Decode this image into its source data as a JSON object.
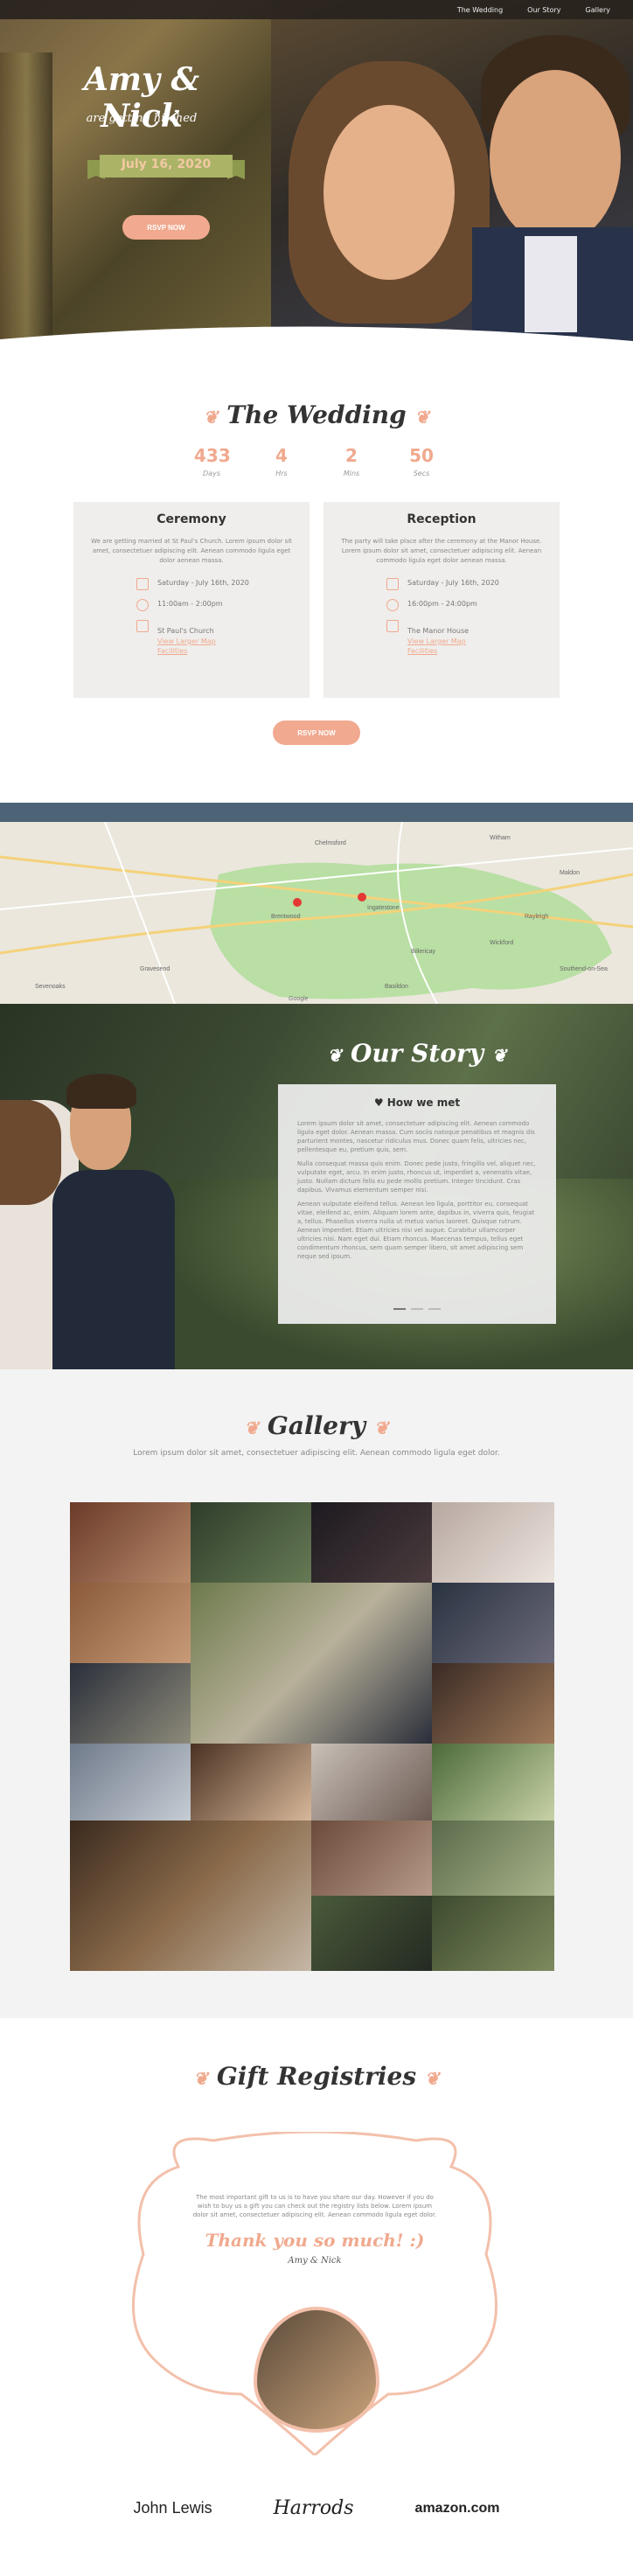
{
  "nav": {
    "items": [
      "The Wedding",
      "Our Story",
      "Gallery"
    ]
  },
  "hero": {
    "title": "Amy & Nick",
    "subtitle": "are getting hitched",
    "date": "July 16, 2020",
    "rsvp_label": "RSVP NOW"
  },
  "wedding": {
    "title": "The Wedding",
    "countdown": [
      {
        "value": "433",
        "label": "Days"
      },
      {
        "value": "4",
        "label": "Hrs"
      },
      {
        "value": "2",
        "label": "Mins"
      },
      {
        "value": "50",
        "label": "Secs"
      }
    ],
    "ceremony": {
      "title": "Ceremony",
      "desc": "We are getting married at St Paul's Church. Lorem ipsum dolor sit amet, consectetuer adipiscing elit. Aenean commodo ligula eget dolor aenean massa.",
      "date": "Saturday - July 16th, 2020",
      "time": "11:00am - 2:00pm",
      "venue": "St Paul's Church",
      "link1": "View Larger Map",
      "link2": "Facilities"
    },
    "reception": {
      "title": "Reception",
      "desc": "The party will take place after the ceremony at the Manor House. Lorem ipsum dolor sit amet, consectetuer adipiscing elit. Aenean commodo ligula eget dolor aenean massa.",
      "date": "Saturday - July 16th, 2020",
      "time": "16:00pm - 24:00pm",
      "venue": "The Manor House",
      "link1": "View Larger Map",
      "link2": "Facilities"
    },
    "rsvp_label": "RSVP NOW"
  },
  "map": {
    "places": [
      "Chelmsford",
      "Ingatestone",
      "Billericay",
      "Brentwood",
      "Basildon",
      "Witham",
      "Maldon",
      "Southend-on-Sea",
      "Wickford",
      "Rayleigh",
      "Sevenoaks",
      "Gravesend"
    ],
    "footer": "Google",
    "pin_color": "#e53935"
  },
  "story": {
    "title": "Our Story",
    "card_title": "How we met",
    "paragraphs": [
      "Lorem ipsum dolor sit amet, consectetuer adipiscing elit. Aenean commodo ligula eget dolor. Aenean massa. Cum sociis natoque penatibus et magnis dis parturient montes, nascetur ridiculus mus. Donec quam felis, ultricies nec, pellentesque eu, pretium quis, sem.",
      "Nulla consequat massa quis enim. Donec pede justo, fringilla vel, aliquet nec, vulputate eget, arcu. In enim justo, rhoncus ut, imperdiet a, venenatis vitae, justo. Nullam dictum felis eu pede mollis pretium. Integer tincidunt. Cras dapibus. Vivamus elementum semper nisi.",
      "Aenean vulputate eleifend tellus. Aenean leo ligula, porttitor eu, consequat vitae, eleifend ac, enim. Aliquam lorem ante, dapibus in, viverra quis, feugiat a, tellus. Phasellus viverra nulla ut metus varius laoreet. Quisque rutrum. Aenean imperdiet. Etiam ultricies nisi vel augue. Curabitur ullamcorper ultricies nisi. Nam eget dui. Etiam rhoncus. Maecenas tempus, tellus eget condimentum rhoncus, sem quam semper libero, sit amet adipiscing sem neque sed ipsum."
    ]
  },
  "gallery": {
    "title": "Gallery",
    "subtitle": "Lorem ipsum dolor sit amet, consectetuer adipiscing elit. Aenean commodo ligula eget dolor."
  },
  "gifts": {
    "title": "Gift Registries",
    "text": "The most important gift to us is to have you share our day. However if you do wish to buy us a gift you can check out the registry lists below. Lorem ipsum dolor sit amet, consectetuer adipiscing elit. Aenean commodo ligula eget dolor.",
    "thanks": "Thank you so much! :)",
    "signature": "Amy & Nick",
    "logos": [
      "John Lewis",
      "Harrods",
      "amazon.com"
    ]
  },
  "colors": {
    "accent": "#f0a98e",
    "nav_bg": "#28231e",
    "map_bar": "#4c6475"
  }
}
